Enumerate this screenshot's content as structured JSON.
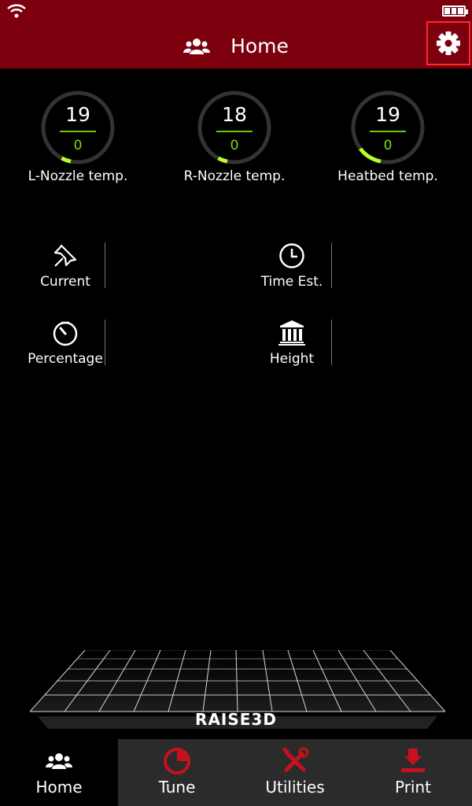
{
  "header": {
    "title": "Home"
  },
  "gauges": [
    {
      "value": "19",
      "target": "0",
      "label": "L-Nozzle temp."
    },
    {
      "value": "18",
      "target": "0",
      "label": "R-Nozzle temp."
    },
    {
      "value": "19",
      "target": "0",
      "label": "Heatbed temp."
    }
  ],
  "info": {
    "current": "Current",
    "time_est": "Time Est.",
    "percentage": "Percentage",
    "height": "Height"
  },
  "brand": "RAISE3D",
  "tabs": [
    {
      "label": "Home",
      "icon": "users-icon",
      "active": true
    },
    {
      "label": "Tune",
      "icon": "pie-chart-icon"
    },
    {
      "label": "Utilities",
      "icon": "tools-icon"
    },
    {
      "label": "Print",
      "icon": "print-icon"
    }
  ],
  "colors": {
    "header_bg": "#7c000e",
    "accent_red": "#c8101e",
    "gauge_green": "#b4ff2a",
    "tabbar_bg": "#2b2b2b"
  }
}
